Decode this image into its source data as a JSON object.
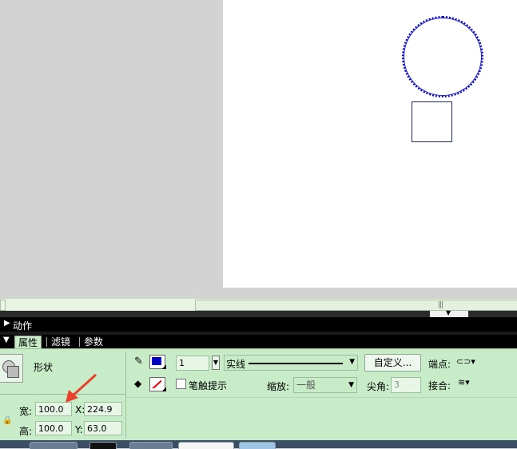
{
  "actions_panel": {
    "title": "动作"
  },
  "tabs": [
    {
      "label": "属性",
      "active": true
    },
    {
      "label": "滤镜",
      "active": false
    },
    {
      "label": "参数",
      "active": false
    }
  ],
  "properties": {
    "shape_label": "形状",
    "width_label": "宽:",
    "width_value": "100.0",
    "height_label": "高:",
    "height_value": "100.0",
    "x_label": "X:",
    "x_value": "224.9",
    "y_label": "Y:",
    "y_value": "63.0"
  },
  "stroke": {
    "color": "#0000c0",
    "height_value": "1",
    "style_label": "实线",
    "custom_button": "自定义...",
    "cap_label": "端点:",
    "join_label": "接合:",
    "stroke_hint_label": "笔触提示",
    "scale_label": "缩放:",
    "scale_value": "一般",
    "miter_label": "尖角:",
    "miter_value": "3"
  },
  "fill": {
    "color": "none"
  },
  "scrollbar": {
    "grip": "|||"
  },
  "colors": {
    "panel_bg": "#c8ecc8",
    "stage_bg": "#ffffff",
    "circle_stroke": "#0000c8"
  }
}
